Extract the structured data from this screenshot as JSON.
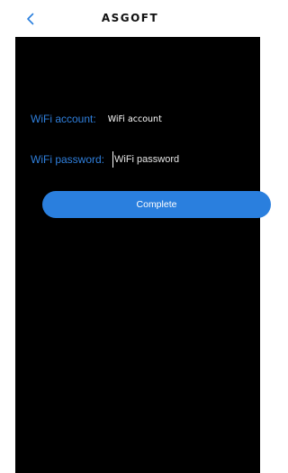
{
  "header": {
    "back_icon": "chevron-left-icon",
    "logo_text": "ASGOFT",
    "accent_color": "#2a7fde"
  },
  "form": {
    "account_label": "WiFi account:",
    "account_value": "WiFi account",
    "password_label": "WiFi password:",
    "password_placeholder": "WiFi password",
    "password_value": ""
  },
  "actions": {
    "complete_label": "Complete"
  },
  "colors": {
    "background": "#000000",
    "label": "#2f7fdc",
    "button": "#2a7fde"
  }
}
